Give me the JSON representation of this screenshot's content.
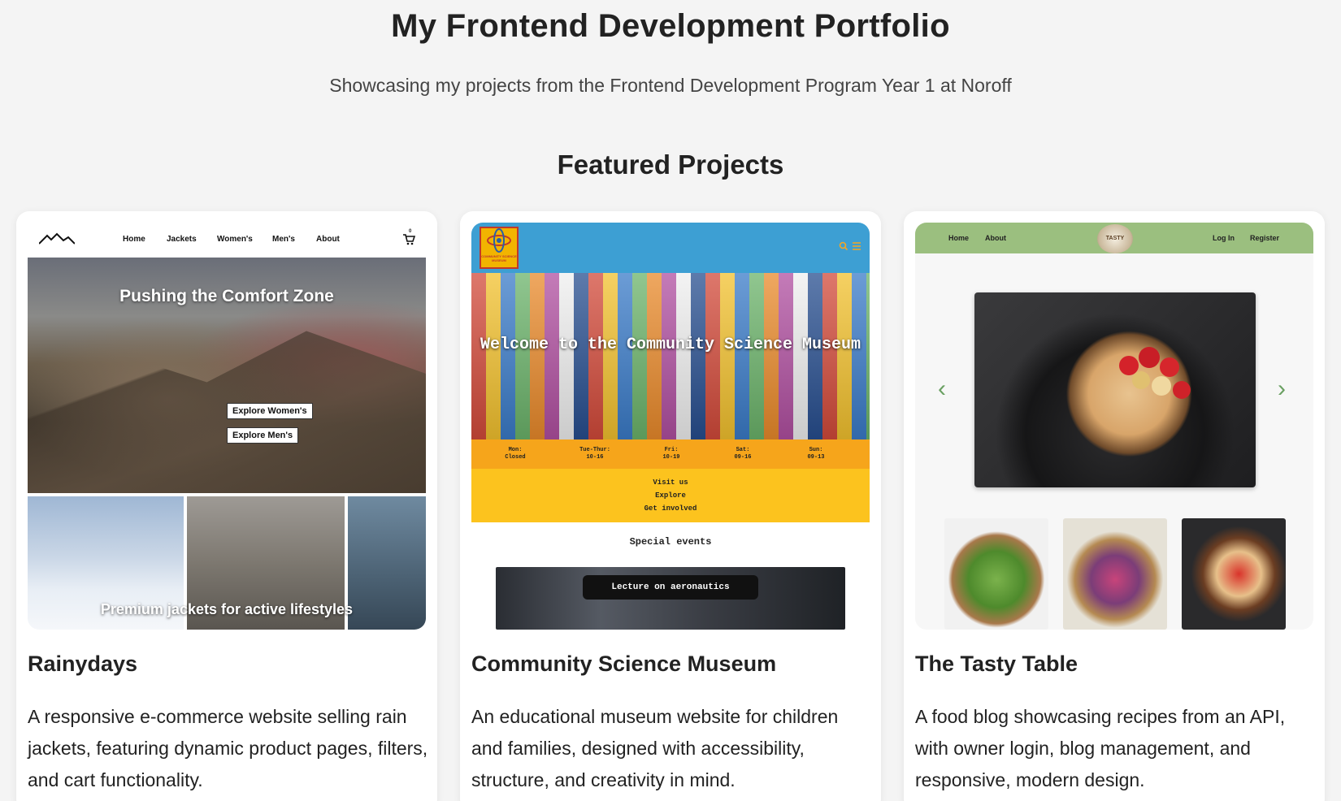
{
  "header": {
    "title": "My Frontend Development Portfolio",
    "subtitle": "Showcasing my projects from the Frontend Development Program Year 1 at Noroff"
  },
  "section": {
    "title": "Featured Projects"
  },
  "projects": [
    {
      "title": "Rainydays",
      "description": "A responsive e-commerce website selling rain jackets, featuring dynamic product pages, filters, and cart functionality.",
      "preview": {
        "nav": [
          "Home",
          "Jackets",
          "Women's",
          "Men's",
          "About"
        ],
        "cart_count": "0",
        "hero_title": "Pushing the Comfort Zone",
        "buttons": [
          "Explore Women's",
          "Explore Men's"
        ],
        "strip_caption": "Premium jackets for active lifestyles"
      }
    },
    {
      "title": "Community Science Museum",
      "description": "An educational museum website for children and families, designed with accessibility, structure, and creativity in mind.",
      "preview": {
        "logo_text": "COMMUNITY SCIENCE MUSEUM",
        "hero_title": "Welcome to the Community Science Museum",
        "hours": [
          {
            "day": "Mon:",
            "time": "Closed"
          },
          {
            "day": "Tue-Thur:",
            "time": "10-16"
          },
          {
            "day": "Fri:",
            "time": "10-19"
          },
          {
            "day": "Sat:",
            "time": "09-16"
          },
          {
            "day": "Sun:",
            "time": "09-13"
          }
        ],
        "links": [
          "Visit us",
          "Explore",
          "Get involved"
        ],
        "special_title": "Special events",
        "event_label": "Lecture on aeronautics"
      }
    },
    {
      "title": "The Tasty Table",
      "description": "A food blog showcasing recipes from an API, with owner login, blog management, and responsive, modern design.",
      "preview": {
        "nav_left": [
          "Home",
          "About"
        ],
        "nav_right": [
          "Log In",
          "Register"
        ],
        "logo_text": "TASTY"
      }
    }
  ],
  "colors": {
    "page_bg": "#f4f4f4",
    "museum_blue": "#3d9fd3",
    "museum_orange": "#f6a51b",
    "museum_yellow": "#fcc31e",
    "tasty_green": "#9bbf7f"
  }
}
